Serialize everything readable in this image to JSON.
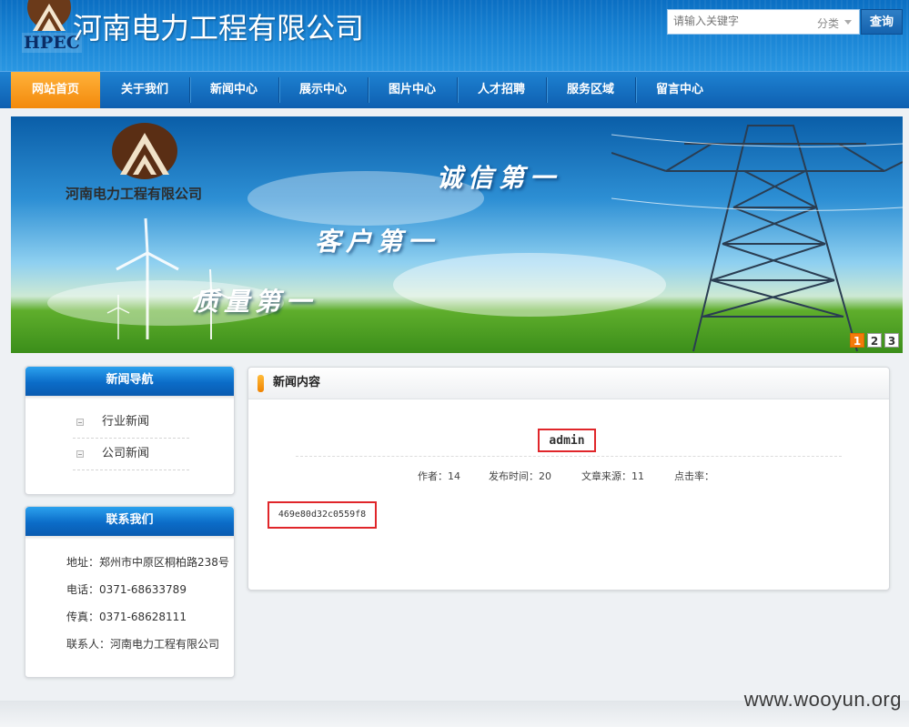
{
  "header": {
    "logo_text": "HPEC",
    "company_name": "河南电力工程有限公司",
    "search": {
      "placeholder": "请输入关键字",
      "category": "分类",
      "button_label": "查询"
    }
  },
  "nav": {
    "items": [
      {
        "label": "网站首页",
        "active": true
      },
      {
        "label": "关于我们"
      },
      {
        "label": "新闻中心"
      },
      {
        "label": "展示中心"
      },
      {
        "label": "图片中心"
      },
      {
        "label": "人才招聘"
      },
      {
        "label": "服务区域"
      },
      {
        "label": "留言中心"
      }
    ]
  },
  "banner": {
    "company_name": "河南电力工程有限公司",
    "slogans": [
      "诚信第一",
      "客户第一",
      "质量第一"
    ],
    "pages": [
      "1",
      "2",
      "3"
    ],
    "active_page": "1",
    "colors": {
      "sky": "#1e78c6",
      "grass": "#4fa024",
      "accent": "#f47a0a"
    }
  },
  "sidebar": {
    "news_nav": {
      "title": "新闻导航",
      "items": [
        "行业新闻",
        "公司新闻"
      ]
    },
    "contact": {
      "title": "联系我们",
      "address": "地址：郑州市中原区桐柏路238号",
      "phone": "电话：0371-68633789",
      "fax": "传真：0371-68628111",
      "contact_person": "联系人：河南电力工程有限公司"
    }
  },
  "content": {
    "header": "新闻内容",
    "article_title": "admin",
    "meta": {
      "author": "作者：14",
      "publish_time": "发布时间：20",
      "source": "文章来源：11",
      "hits": "点击率："
    },
    "body": "469e80d32c0559f8",
    "highlight_color": "#e0262a"
  },
  "watermark": "www.wooyun.org"
}
